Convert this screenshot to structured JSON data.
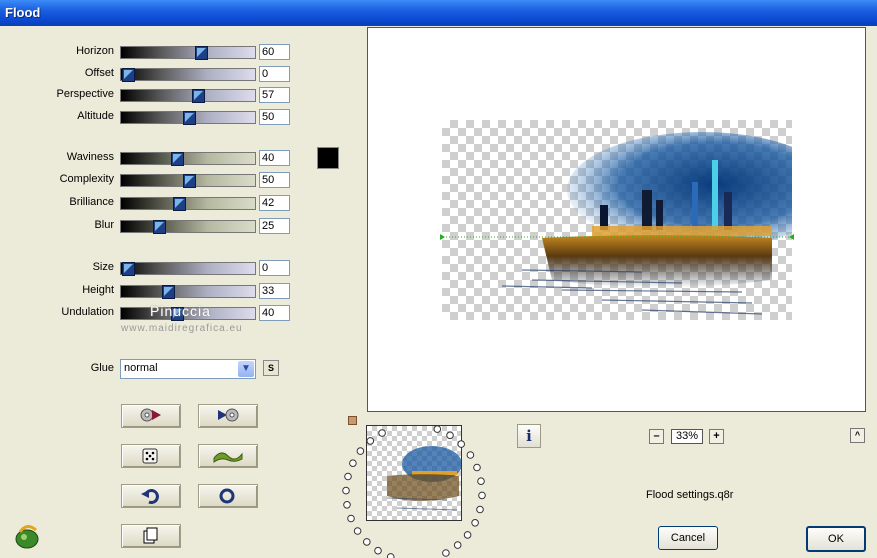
{
  "window": {
    "title": "Flood"
  },
  "sliders": [
    {
      "label": "Horizon",
      "value": "60",
      "level": 0.6
    },
    {
      "label": "Offset",
      "value": "0",
      "level": 0.0
    },
    {
      "label": "Perspective",
      "value": "57",
      "level": 0.57
    },
    {
      "label": "Altitude",
      "value": "50",
      "level": 0.5
    },
    {
      "label": "Waviness",
      "value": "40",
      "level": 0.4
    },
    {
      "label": "Complexity",
      "value": "50",
      "level": 0.5
    },
    {
      "label": "Brilliance",
      "value": "42",
      "level": 0.42
    },
    {
      "label": "Blur",
      "value": "25",
      "level": 0.25
    },
    {
      "label": "Size",
      "value": "0",
      "level": 0.0
    },
    {
      "label": "Height",
      "value": "33",
      "level": 0.33
    },
    {
      "label": "Undulation",
      "value": "40",
      "level": 0.4
    }
  ],
  "color_swatch": "#000000",
  "glue": {
    "label": "Glue",
    "value": "normal",
    "s_button": "S"
  },
  "watermark": {
    "name": "Pinuccia",
    "url": "www.maidiregrafica.eu"
  },
  "tool_buttons": [
    {
      "name": "load-preset-icon"
    },
    {
      "name": "save-preset-icon"
    },
    {
      "name": "randomize-icon"
    },
    {
      "name": "wave-icon"
    },
    {
      "name": "undo-icon"
    },
    {
      "name": "reset-icon"
    },
    {
      "name": "copy-icon"
    }
  ],
  "preview": {
    "zoom": "33%",
    "zoom_minus": "–",
    "zoom_plus": "+"
  },
  "settings_file": "Flood settings.q8r",
  "info_button": "i",
  "scroll_up": "^",
  "buttons": {
    "cancel": "Cancel",
    "ok": "OK"
  }
}
